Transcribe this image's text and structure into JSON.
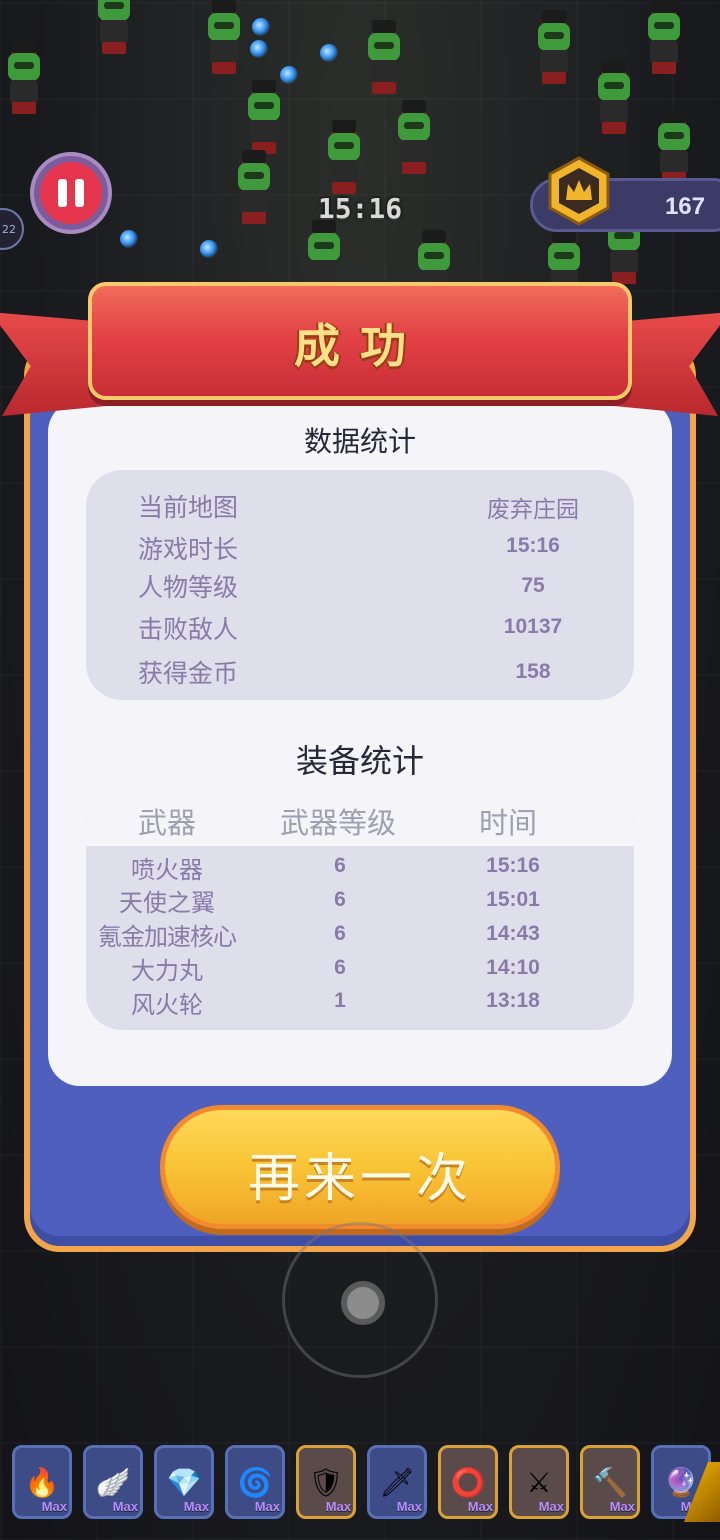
{
  "hud": {
    "timer": "15:16",
    "coin_count": "167",
    "side_chip": "22"
  },
  "dialog": {
    "title": "成功",
    "stats_title": "数据统计",
    "stats": [
      {
        "label": "当前地图",
        "value": "废弃庄园"
      },
      {
        "label": "游戏时长",
        "value": "15:16"
      },
      {
        "label": "人物等级",
        "value": "75"
      },
      {
        "label": "击败敌人",
        "value": "10137"
      },
      {
        "label": "获得金币",
        "value": "158"
      }
    ],
    "equip_title": "装备统计",
    "equip_headers": {
      "weapon": "武器",
      "level": "武器等级",
      "time": "时间"
    },
    "equipment": [
      {
        "name": "喷火器",
        "level": "6",
        "time": "15:16"
      },
      {
        "name": "天使之翼",
        "level": "6",
        "time": "15:01"
      },
      {
        "name": "氪金加速核心",
        "level": "6",
        "time": "14:43"
      },
      {
        "name": "大力丸",
        "level": "6",
        "time": "14:10"
      },
      {
        "name": "风火轮",
        "level": "1",
        "time": "13:18"
      }
    ],
    "retry_label": "再来一次"
  },
  "skills": [
    {
      "icon": "flamethrower-icon",
      "glyph": "🔥",
      "badge": "Max"
    },
    {
      "icon": "angel-wings-icon",
      "glyph": "🪽",
      "badge": "Max"
    },
    {
      "icon": "crystal-icon",
      "glyph": "💎",
      "badge": "Max"
    },
    {
      "icon": "blue-orb-icon",
      "glyph": "🌀",
      "badge": "Max"
    },
    {
      "icon": "spiked-shield-icon",
      "glyph": "🛡",
      "badge": "Max"
    },
    {
      "icon": "spear-icon",
      "glyph": "🗡",
      "badge": "Max"
    },
    {
      "icon": "red-ring-icon",
      "glyph": "⭕",
      "badge": "Max"
    },
    {
      "icon": "sword-icon",
      "glyph": "⚔",
      "badge": "Max"
    },
    {
      "icon": "torch-icon",
      "glyph": "🔨",
      "badge": "Max"
    },
    {
      "icon": "purple-rune-icon",
      "glyph": "🔮",
      "badge": "Max"
    }
  ],
  "colors": {
    "dialog_frame": "#4e5fbd",
    "dialog_border": "#f3a548",
    "ribbon": "#e34347",
    "button": "#f9c436",
    "stat_text": "#8a7aa8"
  }
}
